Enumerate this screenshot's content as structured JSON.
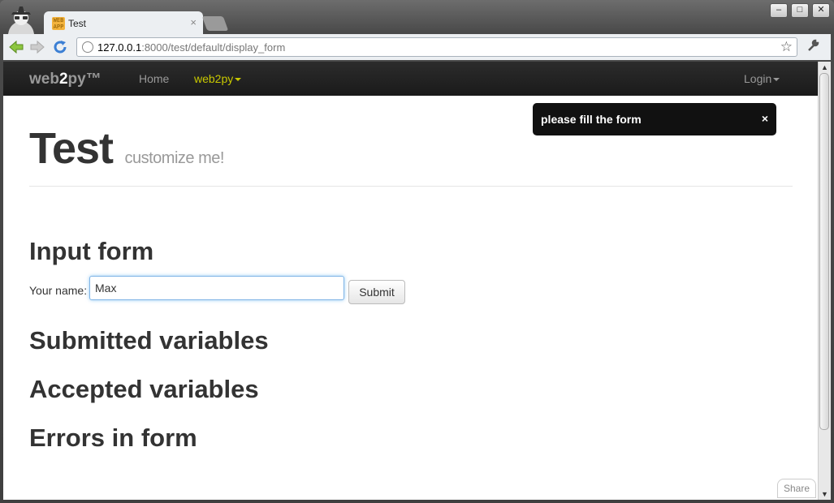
{
  "window": {
    "tab_title": "Test",
    "tab_close": "×",
    "favicon_text": "WEB APP",
    "minimize": "–",
    "maximize": "□",
    "close": "✕"
  },
  "toolbar": {
    "url_host": "127.0.0.1",
    "url_path": ":8000/test/default/display_form",
    "star_icon": "☆",
    "wrench_icon": "🔧"
  },
  "navbar": {
    "brand_prefix": "web",
    "brand_bold": "2",
    "brand_suffix": "py™",
    "home": "Home",
    "web2py": "web2py",
    "login": "Login",
    "active_color": "#c8c800"
  },
  "flash": {
    "message": "please fill the form",
    "close": "×"
  },
  "header": {
    "title": "Test",
    "subtitle": "customize me!"
  },
  "form": {
    "heading": "Input form",
    "label": "Your name:",
    "value": "Max",
    "submit": "Submit"
  },
  "sections": {
    "submitted": "Submitted variables",
    "accepted": "Accepted variables",
    "errors": "Errors in form"
  },
  "share": "Share"
}
